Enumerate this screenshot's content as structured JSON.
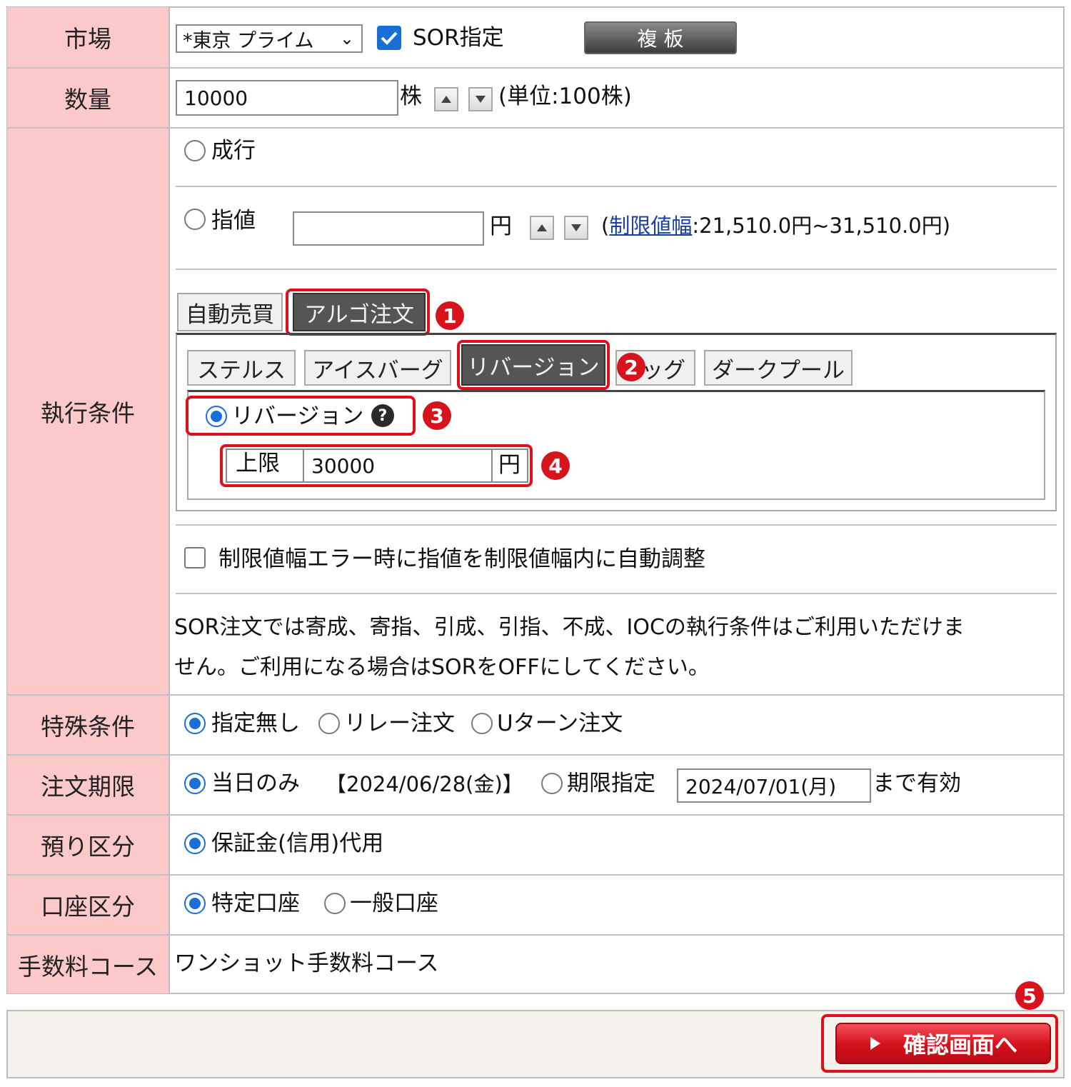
{
  "labels": {
    "market": "市場",
    "quantity": "数量",
    "exec": "執行条件",
    "special": "特殊条件",
    "expiry": "注文期限",
    "deposit": "預り区分",
    "account": "口座区分",
    "fee": "手数料コース"
  },
  "market": {
    "select_value": "*東京 プライム",
    "sor_label": "SOR指定",
    "sor_checked": true,
    "board_button": "複 板"
  },
  "quantity": {
    "value": "10000",
    "unit": "株",
    "note": "(単位:100株)"
  },
  "exec": {
    "market_order": "成行",
    "limit_order": "指値",
    "limit_value": "",
    "yen": "円",
    "range_open": "(",
    "range_link": "制限値幅",
    "range_text": ":21,510.0円~31,510.0円)",
    "tab_auto": "自動売買",
    "tab_algo": "アルゴ注文",
    "subtabs": [
      "ステルス",
      "アイスバーグ",
      "リバージョン",
      "ッグ",
      "ダークプール"
    ],
    "reversion_label": "リバージョン",
    "help_icon": "?",
    "upper_label": "上限",
    "upper_value": "30000",
    "upper_unit": "円",
    "auto_adjust": "制限値幅エラー時に指値を制限値幅内に自動調整",
    "notice_line1": "SOR注文では寄成、寄指、引成、引指、不成、IOCの執行条件はご利用いただけま",
    "notice_line2": "せん。ご利用になる場合はSORをOFFにしてください。"
  },
  "special": {
    "options": [
      "指定無し",
      "リレー注文",
      "Uターン注文"
    ],
    "selected": "指定無し"
  },
  "expiry": {
    "today": "当日のみ",
    "today_date": "【2024/06/28(金)】",
    "period": "期限指定",
    "period_value": "2024/07/01(月)",
    "suffix": "まで有効"
  },
  "deposit": {
    "option": "保証金(信用)代用"
  },
  "account": {
    "options": [
      "特定口座",
      "一般口座"
    ],
    "selected": "特定口座"
  },
  "fee": {
    "value": "ワンショット手数料コース"
  },
  "confirm_button": "確認画面へ",
  "badges": [
    "1",
    "2",
    "3",
    "4",
    "5"
  ],
  "colors": {
    "label_bg": "#fbc9c9",
    "highlight": "#e0101a",
    "radio": "#1a6fd6",
    "confirm": "#e0141e"
  }
}
